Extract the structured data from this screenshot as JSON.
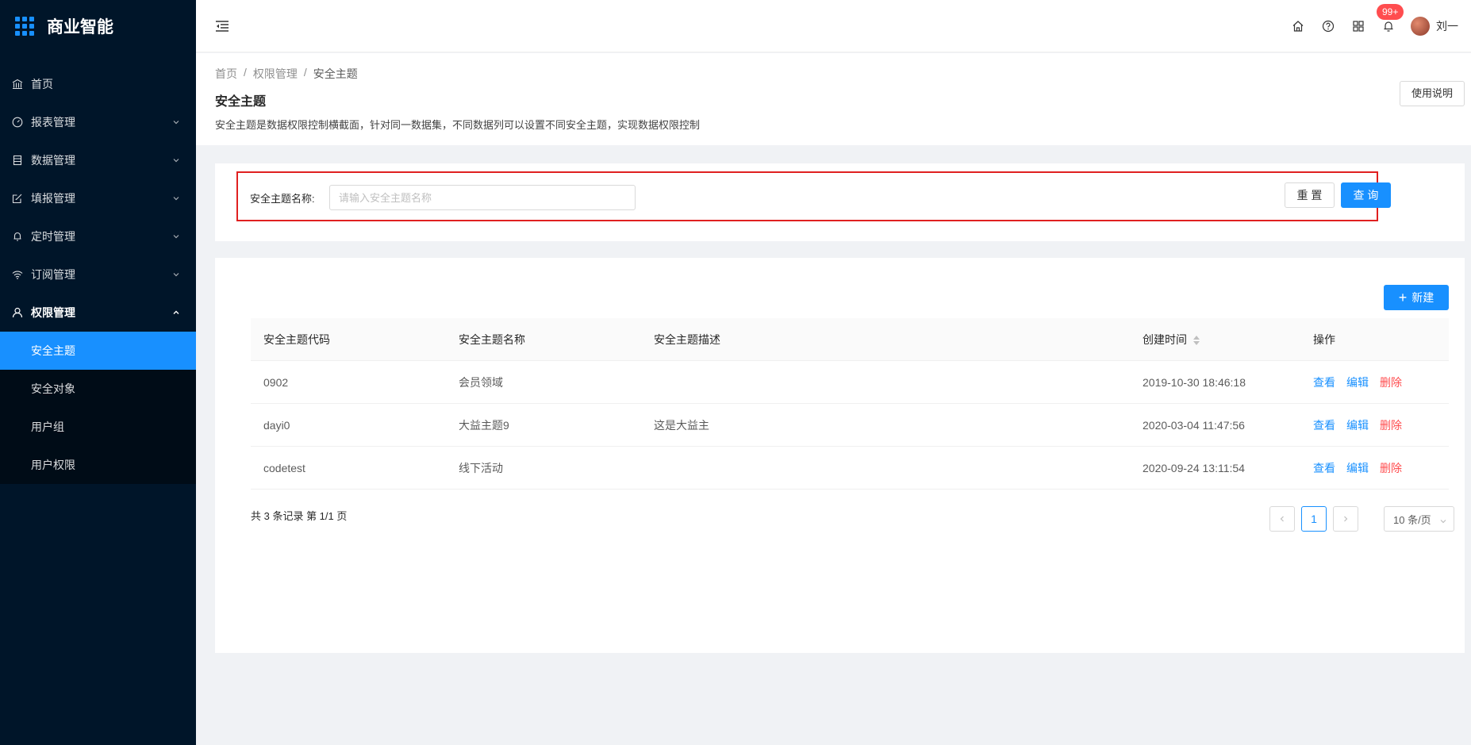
{
  "app": {
    "title": "商业智能"
  },
  "sidebar": {
    "items": [
      {
        "label": "首页",
        "icon": "bank-icon"
      },
      {
        "label": "报表管理",
        "icon": "dashboard-icon"
      },
      {
        "label": "数据管理",
        "icon": "database-icon"
      },
      {
        "label": "填报管理",
        "icon": "edit-icon"
      },
      {
        "label": "定时管理",
        "icon": "bell-icon"
      },
      {
        "label": "订阅管理",
        "icon": "wifi-icon"
      },
      {
        "label": "权限管理",
        "icon": "user-icon"
      }
    ],
    "submenu": [
      {
        "label": "安全主题"
      },
      {
        "label": "安全对象"
      },
      {
        "label": "用户组"
      },
      {
        "label": "用户权限"
      }
    ]
  },
  "header": {
    "badge": "99+",
    "user_name": "刘一"
  },
  "page": {
    "breadcrumb": [
      "首页",
      "权限管理",
      "安全主题"
    ],
    "title": "安全主题",
    "description": "安全主题是数据权限控制横截面，针对同一数据集，不同数据列可以设置不同安全主题，实现数据权限控制",
    "help_label": "使用说明"
  },
  "search": {
    "label": "安全主题名称:",
    "placeholder": "请输入安全主题名称",
    "value": "",
    "reset_label": "重 置",
    "query_label": "查 询"
  },
  "table": {
    "new_label": "新建",
    "columns": [
      "安全主题代码",
      "安全主题名称",
      "安全主题描述",
      "创建时间",
      "操作"
    ],
    "rows": [
      {
        "code": "0902",
        "name": "会员领域",
        "desc": "",
        "created": "2019-10-30 18:46:18"
      },
      {
        "code": "dayi0",
        "name": "大益主题9",
        "desc": "这是大益主",
        "created": "2020-03-04 11:47:56"
      },
      {
        "code": "codetest",
        "name": "线下活动",
        "desc": "",
        "created": "2020-09-24 13:11:54"
      }
    ],
    "actions": {
      "view": "查看",
      "edit": "编辑",
      "delete": "删除"
    }
  },
  "pagination": {
    "total_text": "共 3 条记录 第 1/1 页",
    "current_page": "1",
    "page_size": "10 条/页"
  },
  "colors": {
    "primary": "#1890ff",
    "danger": "#ff4d4f",
    "sidebar_bg": "#001529",
    "highlight_border": "#e02020"
  }
}
